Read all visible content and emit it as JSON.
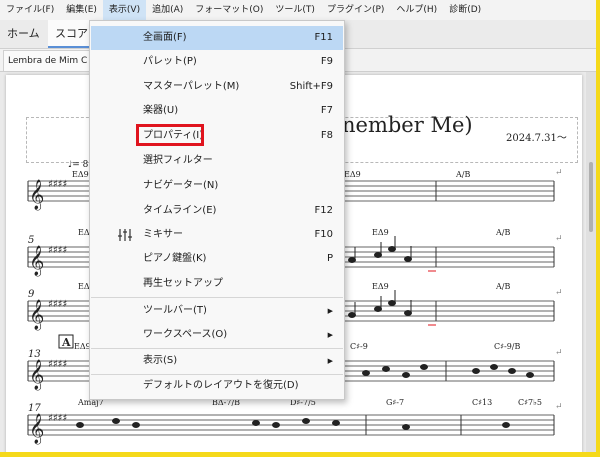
{
  "menubar": {
    "items": [
      "ファイル(F)",
      "編集(E)",
      "表示(V)",
      "追加(A)",
      "フォーマット(O)",
      "ツール(T)",
      "プラグイン(P)",
      "ヘルプ(H)",
      "診断(D)"
    ],
    "active_index": 2
  },
  "tabs": {
    "home": "ホーム",
    "score": "スコア"
  },
  "document_tab": "Lembra de Mim C",
  "score": {
    "title_fragment": "nember Me)",
    "date": "2024.7.31〜",
    "tempo": "♩= 85",
    "rehearsal_mark": "A",
    "measure_numbers": [
      "5",
      "9",
      "13",
      "17"
    ],
    "chords": {
      "row1": [
        "EΔ9",
        "EΔ9",
        "A/B"
      ],
      "row2": [
        "EΔ9",
        "EΔ9",
        "A/B"
      ],
      "row3": [
        "EΔ9",
        "EΔ9",
        "A/B"
      ],
      "row4": [
        "EΔ9",
        "C♯-9",
        "C♯-9/B"
      ],
      "row5": [
        "Amaj7",
        "BΔ-7/B",
        "D♯-7/5",
        "G♯-7",
        "C♯13",
        "C♯7♭5"
      ]
    },
    "accent_colors": {
      "playback_note": "#e0141e"
    }
  },
  "view_menu": {
    "items": [
      {
        "label": "全画面(F)",
        "shortcut": "F11",
        "highlighted": true
      },
      {
        "label": "パレット(P)",
        "shortcut": "F9"
      },
      {
        "label": "マスターパレット(M)",
        "shortcut": "Shift+F9"
      },
      {
        "label": "楽器(U)",
        "shortcut": "F7"
      },
      {
        "label": "プロパティ(I)",
        "shortcut": "F8",
        "marked": true
      },
      {
        "label": "選択フィルター",
        "shortcut": ""
      },
      {
        "label": "ナビゲーター(N)",
        "shortcut": ""
      },
      {
        "label": "タイムライン(E)",
        "shortcut": "F12"
      },
      {
        "label": "ミキサー",
        "shortcut": "F10",
        "icon": "mixer-icon"
      },
      {
        "label": "ピアノ鍵盤(K)",
        "shortcut": "P"
      },
      {
        "label": "再生セットアップ",
        "shortcut": ""
      },
      {
        "label": "ツールバー(T)",
        "submenu": true
      },
      {
        "label": "ワークスペース(O)",
        "submenu": true
      },
      {
        "label": "表示(S)",
        "submenu": true
      },
      {
        "label": "デフォルトのレイアウトを復元(D)",
        "shortcut": ""
      }
    ],
    "highlight_color": "#e0141e"
  }
}
